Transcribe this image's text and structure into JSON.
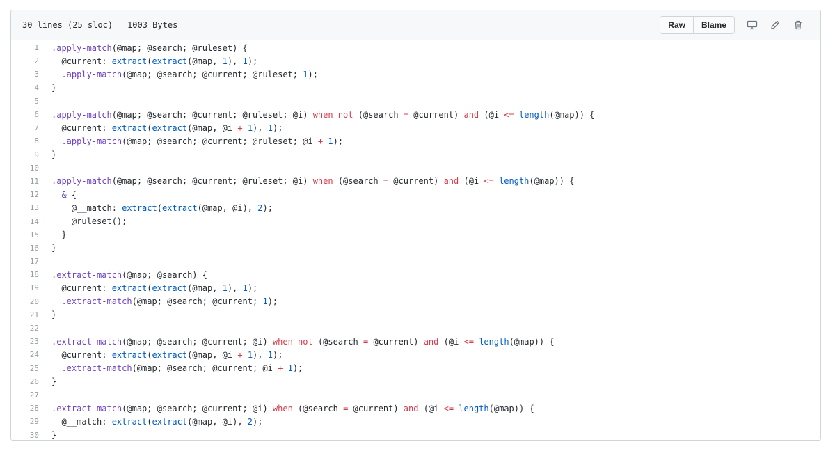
{
  "header": {
    "lines_info": "30 lines (25 sloc)",
    "size_info": "1003 Bytes",
    "raw_label": "Raw",
    "blame_label": "Blame"
  },
  "code_lines": [
    {
      "n": "1",
      "t": [
        [
          ".apply-match",
          "e"
        ],
        [
          "(@map; @search; @ruleset) {",
          ""
        ]
      ]
    },
    {
      "n": "2",
      "t": [
        [
          "  @current: ",
          ""
        ],
        [
          "extract",
          "f"
        ],
        [
          "(",
          ""
        ],
        [
          "extract",
          "f"
        ],
        [
          "(@map, ",
          ""
        ],
        [
          "1",
          "n"
        ],
        [
          "), ",
          ""
        ],
        [
          "1",
          "n"
        ],
        [
          ");",
          ""
        ]
      ]
    },
    {
      "n": "3",
      "t": [
        [
          "  ",
          ""
        ],
        [
          ".apply-match",
          "e"
        ],
        [
          "(@map; @search; @current; @ruleset; ",
          ""
        ],
        [
          "1",
          "n"
        ],
        [
          ");",
          ""
        ]
      ]
    },
    {
      "n": "4",
      "t": [
        [
          "}",
          ""
        ]
      ]
    },
    {
      "n": "5",
      "t": []
    },
    {
      "n": "6",
      "t": [
        [
          ".apply-match",
          "e"
        ],
        [
          "(@map; @search; @current; @ruleset; @i) ",
          ""
        ],
        [
          "when",
          "k"
        ],
        [
          " ",
          ""
        ],
        [
          "not",
          "k"
        ],
        [
          " (@search ",
          ""
        ],
        [
          "=",
          "o"
        ],
        [
          " @current) ",
          ""
        ],
        [
          "and",
          "k"
        ],
        [
          " (@i ",
          ""
        ],
        [
          "<=",
          "o"
        ],
        [
          " ",
          ""
        ],
        [
          "length",
          "f"
        ],
        [
          "(@map)) {",
          ""
        ]
      ]
    },
    {
      "n": "7",
      "t": [
        [
          "  @current: ",
          ""
        ],
        [
          "extract",
          "f"
        ],
        [
          "(",
          ""
        ],
        [
          "extract",
          "f"
        ],
        [
          "(@map, @i ",
          ""
        ],
        [
          "+",
          "o"
        ],
        [
          " ",
          ""
        ],
        [
          "1",
          "n"
        ],
        [
          "), ",
          ""
        ],
        [
          "1",
          "n"
        ],
        [
          ");",
          ""
        ]
      ]
    },
    {
      "n": "8",
      "t": [
        [
          "  ",
          ""
        ],
        [
          ".apply-match",
          "e"
        ],
        [
          "(@map; @search; @current; @ruleset; @i ",
          ""
        ],
        [
          "+",
          "o"
        ],
        [
          " ",
          ""
        ],
        [
          "1",
          "n"
        ],
        [
          ");",
          ""
        ]
      ]
    },
    {
      "n": "9",
      "t": [
        [
          "}",
          ""
        ]
      ]
    },
    {
      "n": "10",
      "t": []
    },
    {
      "n": "11",
      "t": [
        [
          ".apply-match",
          "e"
        ],
        [
          "(@map; @search; @current; @ruleset; @i) ",
          ""
        ],
        [
          "when",
          "k"
        ],
        [
          " (@search ",
          ""
        ],
        [
          "=",
          "o"
        ],
        [
          " @current) ",
          ""
        ],
        [
          "and",
          "k"
        ],
        [
          " (@i ",
          ""
        ],
        [
          "<=",
          "o"
        ],
        [
          " ",
          ""
        ],
        [
          "length",
          "f"
        ],
        [
          "(@map)) {",
          ""
        ]
      ]
    },
    {
      "n": "12",
      "t": [
        [
          "  ",
          ""
        ],
        [
          "&",
          "e"
        ],
        [
          " {",
          ""
        ]
      ]
    },
    {
      "n": "13",
      "t": [
        [
          "    @__match: ",
          ""
        ],
        [
          "extract",
          "f"
        ],
        [
          "(",
          ""
        ],
        [
          "extract",
          "f"
        ],
        [
          "(@map, @i), ",
          ""
        ],
        [
          "2",
          "n"
        ],
        [
          ");",
          ""
        ]
      ]
    },
    {
      "n": "14",
      "t": [
        [
          "    @ruleset();",
          ""
        ]
      ]
    },
    {
      "n": "15",
      "t": [
        [
          "  }",
          ""
        ]
      ]
    },
    {
      "n": "16",
      "t": [
        [
          "}",
          ""
        ]
      ]
    },
    {
      "n": "17",
      "t": []
    },
    {
      "n": "18",
      "t": [
        [
          ".extract-match",
          "e"
        ],
        [
          "(@map; @search) {",
          ""
        ]
      ]
    },
    {
      "n": "19",
      "t": [
        [
          "  @current: ",
          ""
        ],
        [
          "extract",
          "f"
        ],
        [
          "(",
          ""
        ],
        [
          "extract",
          "f"
        ],
        [
          "(@map, ",
          ""
        ],
        [
          "1",
          "n"
        ],
        [
          "), ",
          ""
        ],
        [
          "1",
          "n"
        ],
        [
          ");",
          ""
        ]
      ]
    },
    {
      "n": "20",
      "t": [
        [
          "  ",
          ""
        ],
        [
          ".extract-match",
          "e"
        ],
        [
          "(@map; @search; @current; ",
          ""
        ],
        [
          "1",
          "n"
        ],
        [
          ");",
          ""
        ]
      ]
    },
    {
      "n": "21",
      "t": [
        [
          "}",
          ""
        ]
      ]
    },
    {
      "n": "22",
      "t": []
    },
    {
      "n": "23",
      "t": [
        [
          ".extract-match",
          "e"
        ],
        [
          "(@map; @search; @current; @i) ",
          ""
        ],
        [
          "when",
          "k"
        ],
        [
          " ",
          ""
        ],
        [
          "not",
          "k"
        ],
        [
          " (@search ",
          ""
        ],
        [
          "=",
          "o"
        ],
        [
          " @current) ",
          ""
        ],
        [
          "and",
          "k"
        ],
        [
          " (@i ",
          ""
        ],
        [
          "<=",
          "o"
        ],
        [
          " ",
          ""
        ],
        [
          "length",
          "f"
        ],
        [
          "(@map)) {",
          ""
        ]
      ]
    },
    {
      "n": "24",
      "t": [
        [
          "  @current: ",
          ""
        ],
        [
          "extract",
          "f"
        ],
        [
          "(",
          ""
        ],
        [
          "extract",
          "f"
        ],
        [
          "(@map, @i ",
          ""
        ],
        [
          "+",
          "o"
        ],
        [
          " ",
          ""
        ],
        [
          "1",
          "n"
        ],
        [
          "), ",
          ""
        ],
        [
          "1",
          "n"
        ],
        [
          ");",
          ""
        ]
      ]
    },
    {
      "n": "25",
      "t": [
        [
          "  ",
          ""
        ],
        [
          ".extract-match",
          "e"
        ],
        [
          "(@map; @search; @current; @i ",
          ""
        ],
        [
          "+",
          "o"
        ],
        [
          " ",
          ""
        ],
        [
          "1",
          "n"
        ],
        [
          ");",
          ""
        ]
      ]
    },
    {
      "n": "26",
      "t": [
        [
          "}",
          ""
        ]
      ]
    },
    {
      "n": "27",
      "t": []
    },
    {
      "n": "28",
      "t": [
        [
          ".extract-match",
          "e"
        ],
        [
          "(@map; @search; @current; @i) ",
          ""
        ],
        [
          "when",
          "k"
        ],
        [
          " (@search ",
          ""
        ],
        [
          "=",
          "o"
        ],
        [
          " @current) ",
          ""
        ],
        [
          "and",
          "k"
        ],
        [
          " (@i ",
          ""
        ],
        [
          "<=",
          "o"
        ],
        [
          " ",
          ""
        ],
        [
          "length",
          "f"
        ],
        [
          "(@map)) {",
          ""
        ]
      ]
    },
    {
      "n": "29",
      "t": [
        [
          "  @__match: ",
          ""
        ],
        [
          "extract",
          "f"
        ],
        [
          "(",
          ""
        ],
        [
          "extract",
          "f"
        ],
        [
          "(@map, @i), ",
          ""
        ],
        [
          "2",
          "n"
        ],
        [
          ");",
          ""
        ]
      ]
    },
    {
      "n": "30",
      "t": [
        [
          "}",
          ""
        ]
      ]
    }
  ],
  "icons": [
    "desktop-icon",
    "pencil-icon",
    "trash-icon"
  ]
}
